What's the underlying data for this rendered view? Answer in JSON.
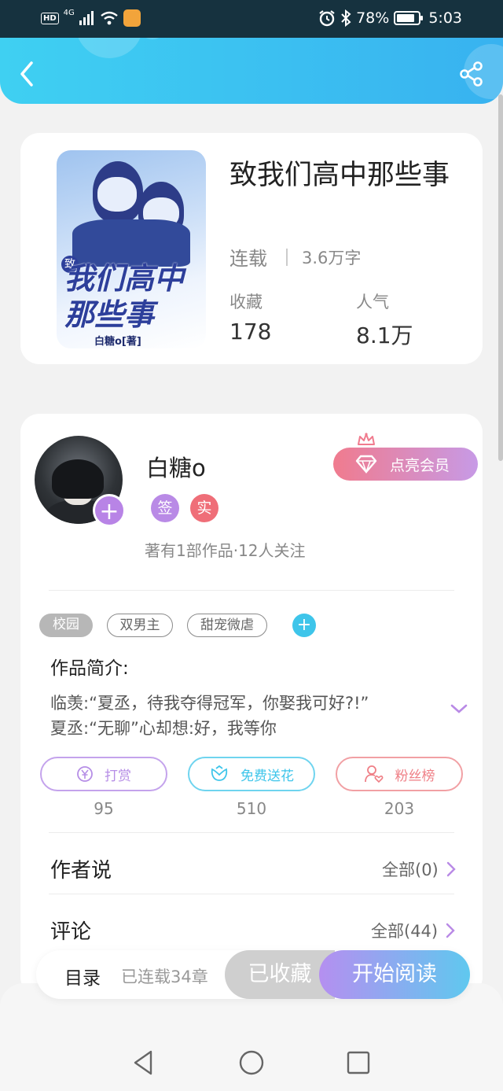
{
  "status_bar": {
    "network": "HD",
    "signal": "4G",
    "battery": "78%",
    "time": "5:03",
    "icons": [
      "hd-icon",
      "signal-icon",
      "wifi-icon",
      "app-notification-icon",
      "alarm-icon",
      "bluetooth-icon",
      "battery-icon"
    ]
  },
  "header": {
    "back_icon": "back-arrow-icon",
    "share_icon": "share-icon",
    "accent": "#3fc6f1"
  },
  "book": {
    "cover_title": "我们高中那些事",
    "cover_zhi": "致",
    "cover_author": "白糖o[著]",
    "title": "致我们高中那些事",
    "status": "连载",
    "word_count": "3.6万字",
    "stats": [
      {
        "label": "收藏",
        "value": "178"
      },
      {
        "label": "人气",
        "value": "8.1万"
      }
    ]
  },
  "author": {
    "name": "白糖o",
    "badges": [
      "签",
      "实"
    ],
    "meta": "著有1部作品·12人关注",
    "vip_button": "点亮会员",
    "follow_icon": "plus-icon"
  },
  "tags": [
    "校园",
    "双男主",
    "甜宠微虐"
  ],
  "intro": {
    "heading": "作品简介:",
    "lines": [
      "临羡:“夏丞，待我夺得冠军，你娶我可好?!”",
      "夏丞:“无聊”心却想:好，我等你"
    ]
  },
  "actions": [
    {
      "label": "打赏",
      "count": "95",
      "icon": "yen-coin-icon",
      "color": "#b68ee6"
    },
    {
      "label": "免费送花",
      "count": "510",
      "icon": "flower-icon",
      "color": "#3ec5ea"
    },
    {
      "label": "粉丝榜",
      "count": "203",
      "icon": "fan-heart-icon",
      "color": "#ef7f86"
    }
  ],
  "sections": [
    {
      "title": "作者说",
      "more": "全部(0)"
    },
    {
      "title": "评论",
      "more": "全部(44)"
    }
  ],
  "bottom_bar": {
    "toc": "目录",
    "chapters": "已连载34章",
    "collected": "已收藏",
    "start_reading": "开始阅读"
  },
  "nav": [
    "back-triangle-icon",
    "home-circle-icon",
    "recents-square-icon"
  ]
}
